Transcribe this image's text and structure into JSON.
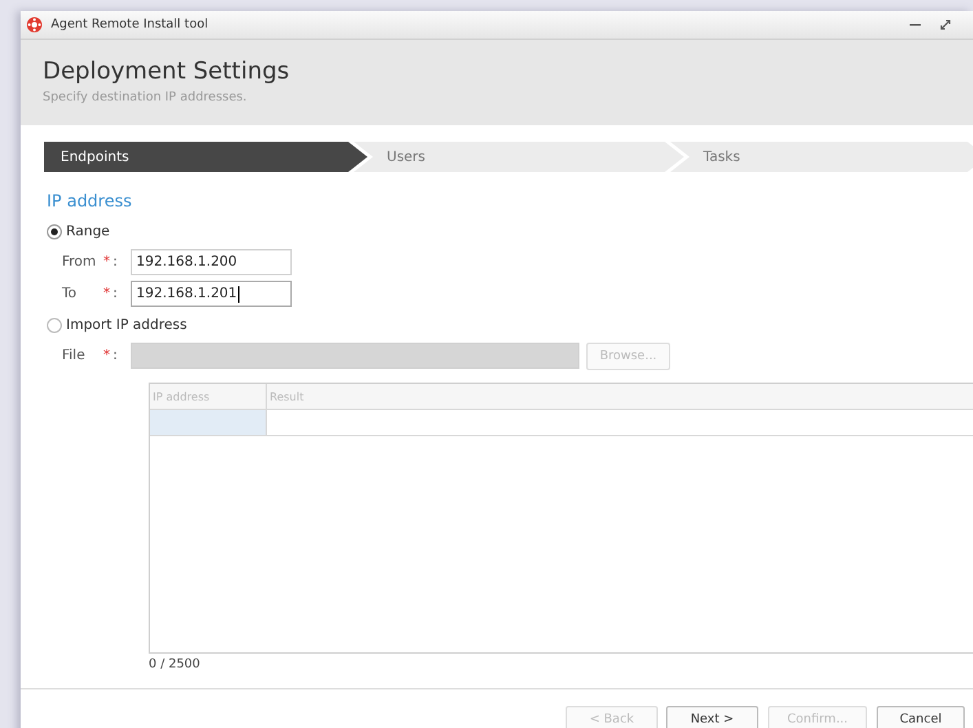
{
  "window": {
    "title": "Agent Remote Install tool"
  },
  "header": {
    "title": "Deployment Settings",
    "subtitle": "Specify destination IP addresses."
  },
  "steps": [
    {
      "label": "Endpoints",
      "selected": true
    },
    {
      "label": "Users",
      "selected": false
    },
    {
      "label": "Tasks",
      "selected": false
    }
  ],
  "section": {
    "title": "IP address"
  },
  "range": {
    "label": "Range",
    "selected": true,
    "fields": [
      {
        "label": "From",
        "mark": "*",
        "separator": ":",
        "value": "192.168.1.200",
        "focused": false
      },
      {
        "label": "To",
        "mark": "*",
        "separator": ":",
        "value": "192.168.1.201",
        "focused": true
      }
    ]
  },
  "import": {
    "label": "Import IP address",
    "selected": false,
    "file": {
      "label": "File",
      "mark": "*",
      "separator": ":",
      "disabled": true
    },
    "browse": {
      "label": "Browse...",
      "disabled": true
    }
  },
  "table": {
    "columns": [
      "IP address",
      "Result"
    ]
  },
  "count": "0 / 2500",
  "buttons": [
    {
      "label": "< Back",
      "disabled": true
    },
    {
      "label": "Next >",
      "disabled": false
    },
    {
      "label": "Confirm...",
      "disabled": true
    },
    {
      "label": "Cancel",
      "disabled": false
    }
  ]
}
